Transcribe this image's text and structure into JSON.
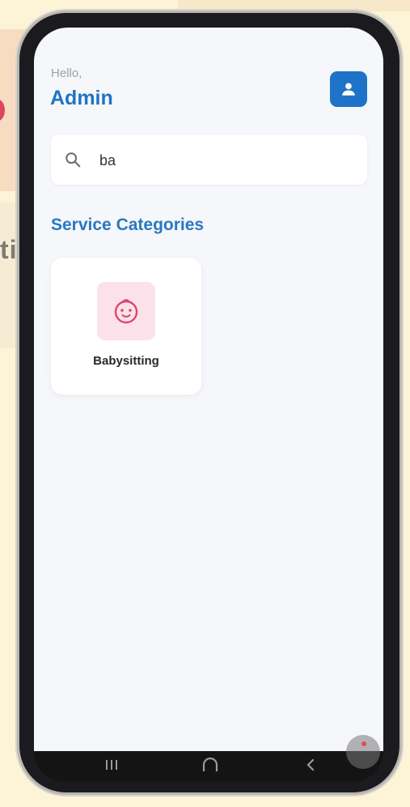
{
  "header": {
    "greeting": "Hello,",
    "user_name": "Admin",
    "profile_icon": "person-icon"
  },
  "search": {
    "value": "ba",
    "placeholder": "",
    "icon": "search-icon"
  },
  "categories": {
    "title": "Service Categories",
    "items": [
      {
        "label": "Babysitting",
        "icon": "baby-face-icon"
      }
    ]
  },
  "background": {
    "partial_text": "ti"
  },
  "navigation": {
    "buttons": [
      "recents",
      "home",
      "back"
    ]
  },
  "colors": {
    "primary": "#1e73c8",
    "title_blue": "#2a78c2",
    "category_icon": "#e0456d",
    "category_icon_bg": "#fbe2ea",
    "screen_bg": "#f5f7fa",
    "page_bg": "#fdf3d6"
  }
}
